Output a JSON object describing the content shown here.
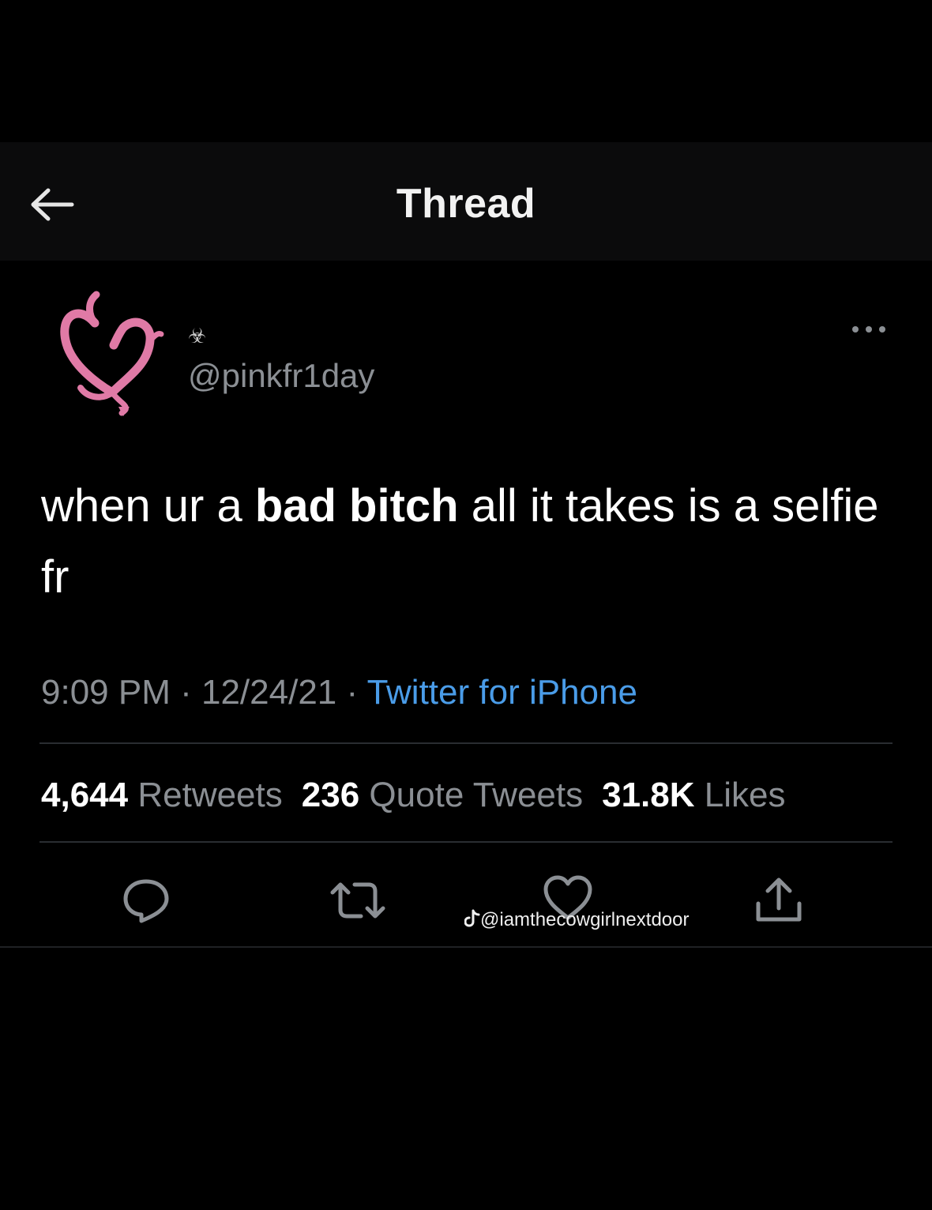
{
  "header": {
    "title": "Thread",
    "back_icon": "arrow-left-icon"
  },
  "tweet": {
    "display_name": "☣",
    "handle": "@pinkfr1day",
    "avatar_icon": "pink-devil-heart-avatar",
    "more_icon": "more-dots-icon",
    "text_before": "when ur a ",
    "text_bold": "bad bitch",
    "text_after": " all it takes is a selfie fr",
    "time": "9:09 PM",
    "date": "12/24/21",
    "separator": " · ",
    "source": "Twitter for iPhone"
  },
  "stats": {
    "retweets_count": "4,644",
    "retweets_label": "Retweets",
    "quotes_count": "236",
    "quotes_label": "Quote Tweets",
    "likes_count": "31.8K",
    "likes_label": "Likes"
  },
  "actions": {
    "reply_icon": "reply-icon",
    "retweet_icon": "retweet-icon",
    "like_icon": "heart-icon",
    "share_icon": "share-icon"
  },
  "watermark": {
    "icon": "tiktok-icon",
    "text": "@iamthecowgirlnextdoor"
  },
  "colors": {
    "background": "#000000",
    "header_background": "#0b0b0c",
    "text": "#ffffff",
    "secondary_text": "#8b8f94",
    "link": "#4a9ce8",
    "avatar_pink": "#e07aa6"
  }
}
